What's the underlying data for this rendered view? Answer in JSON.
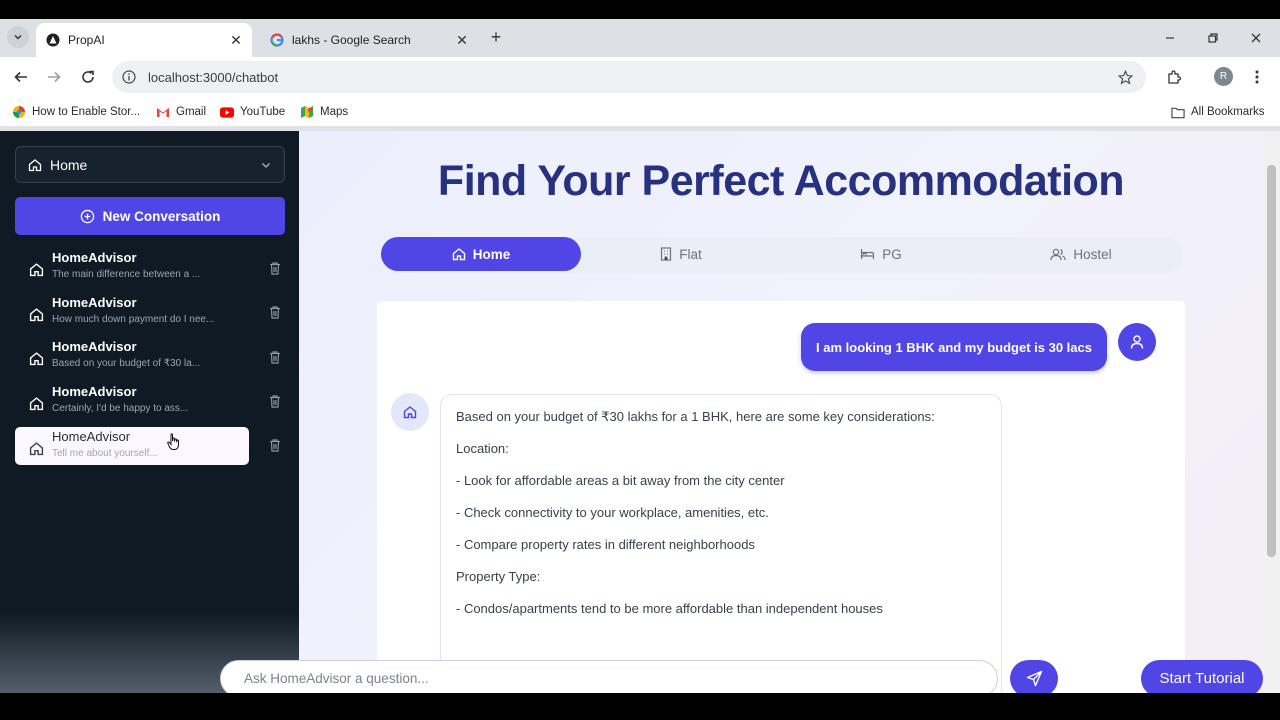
{
  "browser": {
    "tabs": [
      {
        "title": "PropAI",
        "active": true
      },
      {
        "title": "lakhs - Google Search",
        "active": false
      }
    ],
    "address": "localhost:3000/chatbot",
    "profile_initial": "R",
    "bookmarks": [
      {
        "label": "How to Enable Stor...",
        "icon": "drive-icon"
      },
      {
        "label": "Gmail",
        "icon": "gmail-icon"
      },
      {
        "label": "YouTube",
        "icon": "youtube-icon"
      },
      {
        "label": "Maps",
        "icon": "maps-icon"
      }
    ],
    "all_bookmarks": "All Bookmarks"
  },
  "sidebar": {
    "select_value": "Home",
    "new_conversation": "New Conversation",
    "conversations": [
      {
        "title": "HomeAdvisor",
        "preview": "The main difference between a ..."
      },
      {
        "title": "HomeAdvisor",
        "preview": "How much down payment do I nee..."
      },
      {
        "title": "HomeAdvisor",
        "preview": "Based on your budget of ₹30 la..."
      },
      {
        "title": "HomeAdvisor",
        "preview": "Certainly, I'd be happy to ass..."
      },
      {
        "title": "HomeAdvisor",
        "preview": "Tell me about yourself..."
      }
    ]
  },
  "main": {
    "heading": "Find Your Perfect Accommodation",
    "type_tabs": [
      "Home",
      "Flat",
      "PG",
      "Hostel"
    ],
    "user_message": "I am looking 1 BHK and my budget is 30 lacs",
    "bot_lines": [
      "Based on your budget of ₹30 lakhs for a 1 BHK, here are some key considerations:",
      "Location:",
      "- Look for affordable areas a bit away from the city center",
      "- Check connectivity to your workplace, amenities, etc.",
      "- Compare property rates in different neighborhoods",
      "Property Type:",
      "- Condos/apartments tend to be more affordable than independent houses"
    ],
    "input_placeholder": "Ask HomeAdvisor a question...",
    "tutorial_button": "Start Tutorial"
  },
  "colors": {
    "accent": "#4f46e5",
    "heading": "#26317f",
    "sidebar_bg": "#0f1a24"
  }
}
